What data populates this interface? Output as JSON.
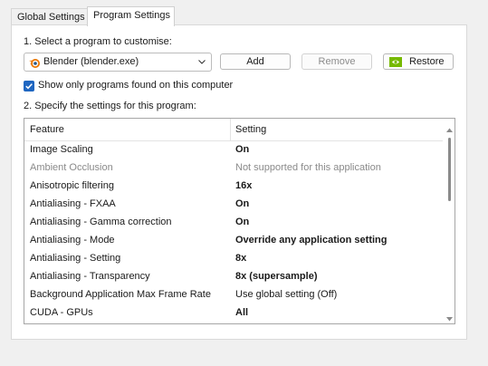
{
  "tabs": [
    {
      "label": "Global Settings",
      "active": false
    },
    {
      "label": "Program Settings",
      "active": true
    }
  ],
  "step1_label": "1. Select a program to customise:",
  "program_select": {
    "value": "Blender (blender.exe)",
    "icon": "blender-logo-icon"
  },
  "buttons": {
    "add": "Add",
    "remove": "Remove",
    "restore": "Restore"
  },
  "show_only_found": {
    "label": "Show only programs found on this computer",
    "checked": true
  },
  "step2_label": "2. Specify the settings for this program:",
  "settings_table": {
    "headers": {
      "feature": "Feature",
      "setting": "Setting"
    },
    "rows": [
      {
        "feature": "Image Scaling",
        "setting": "On",
        "style": "bold"
      },
      {
        "feature": "Ambient Occlusion",
        "setting": "Not supported for this application",
        "style": "disabled"
      },
      {
        "feature": "Anisotropic filtering",
        "setting": "16x",
        "style": "bold"
      },
      {
        "feature": "Antialiasing - FXAA",
        "setting": "On",
        "style": "bold"
      },
      {
        "feature": "Antialiasing - Gamma correction",
        "setting": "On",
        "style": "bold"
      },
      {
        "feature": "Antialiasing - Mode",
        "setting": "Override any application setting",
        "style": "bold"
      },
      {
        "feature": "Antialiasing - Setting",
        "setting": "8x",
        "style": "bold"
      },
      {
        "feature": "Antialiasing - Transparency",
        "setting": "8x (supersample)",
        "style": "bold"
      },
      {
        "feature": "Background Application Max Frame Rate",
        "setting": "Use global setting (Off)",
        "style": "normal"
      },
      {
        "feature": "CUDA - GPUs",
        "setting": "All",
        "style": "bold"
      }
    ]
  },
  "colors": {
    "accent": "#1f66c1",
    "nvidia_green": "#76b900",
    "blender_orange": "#ea7600"
  }
}
